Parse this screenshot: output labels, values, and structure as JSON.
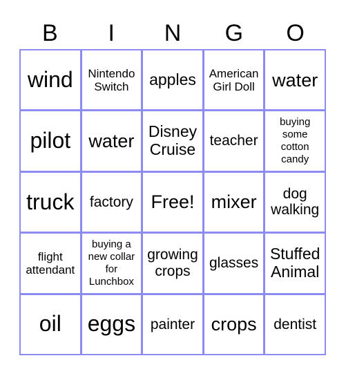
{
  "header": [
    "B",
    "I",
    "N",
    "G",
    "O"
  ],
  "accent_color": "#8c8cf0",
  "cells": [
    [
      "wind",
      "Nintendo Switch",
      "apples",
      "American Girl Doll",
      "water"
    ],
    [
      "pilot",
      "water",
      "Disney Cruise",
      "teacher",
      "buying some cotton candy"
    ],
    [
      "truck",
      "factory",
      "Free!",
      "mixer",
      "dog walking"
    ],
    [
      "flight attendant",
      "buying a new collar for Lunchbox",
      "growing crops",
      "glasses",
      "Stuffed Animal"
    ],
    [
      "oil",
      "eggs",
      "painter",
      "crops",
      "dentist"
    ]
  ]
}
